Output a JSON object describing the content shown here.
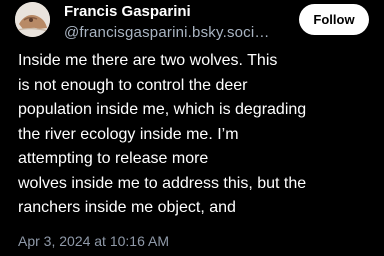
{
  "author": {
    "display_name": "Francis Gasparini",
    "handle": "@francisgasparini.bsky.soci…",
    "avatar_icon": "user-avatar"
  },
  "follow_button": {
    "label": "Follow"
  },
  "post": {
    "text_lines": [
      "Inside me there are two wolves. This",
      "is not enough to control the deer",
      "population inside me, which is degrading",
      "the river ecology inside me. I’m",
      "attempting to release more",
      "wolves inside me to address this, but the",
      "ranchers inside me object, and"
    ],
    "timestamp": "Apr 3, 2024 at 10:16 AM"
  },
  "colors": {
    "background": "#000000",
    "text": "#ffffff",
    "handle": "#a9b4c2",
    "timestamp": "#8f99a8",
    "button_bg": "#ffffff",
    "button_text": "#000000"
  }
}
